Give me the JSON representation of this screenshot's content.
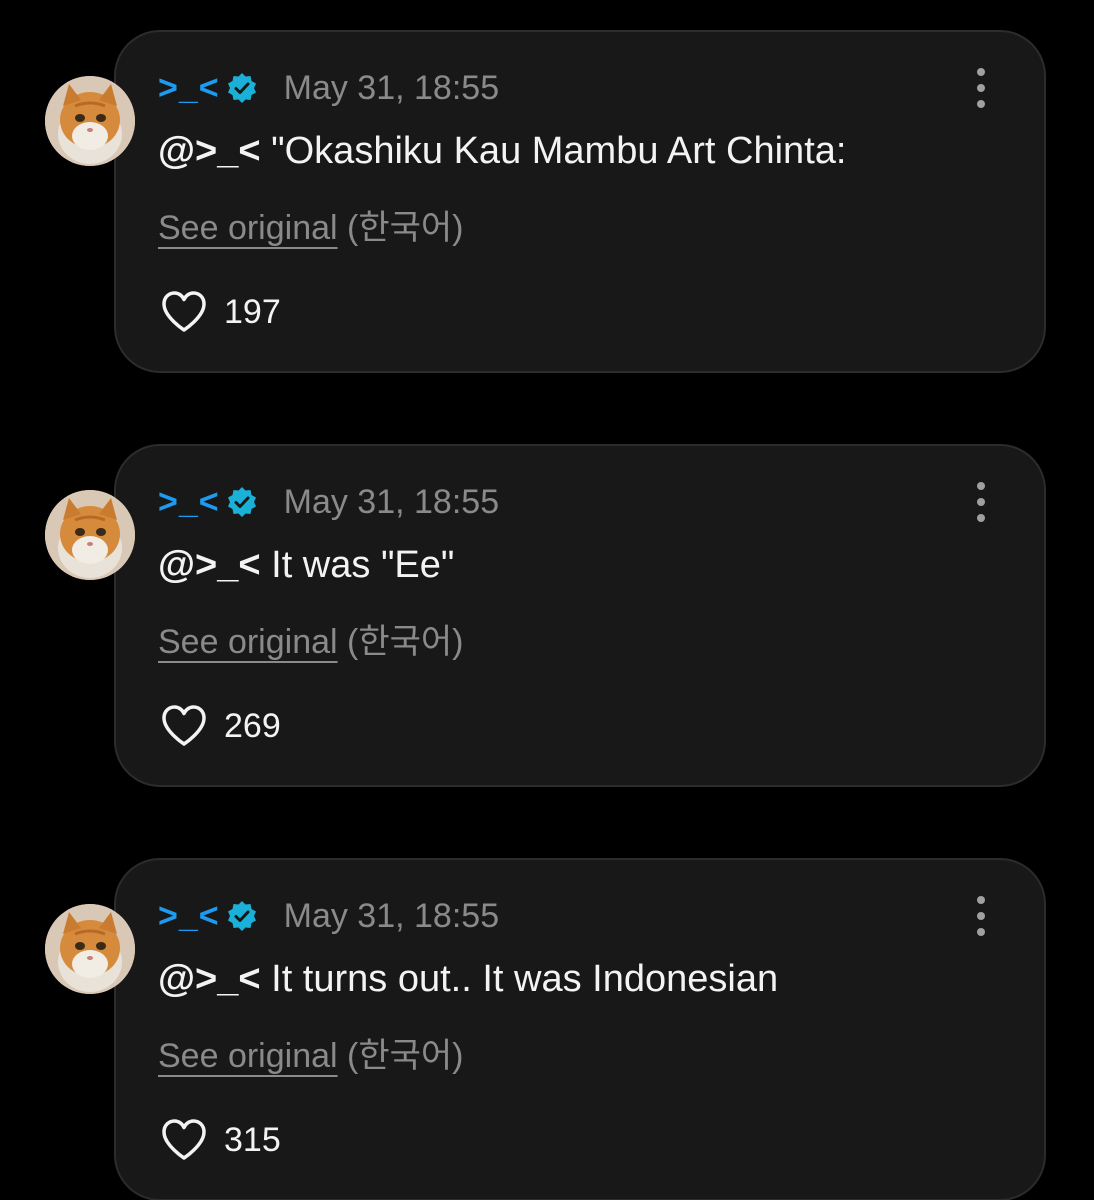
{
  "comments": [
    {
      "username": ">_<",
      "timestamp": "May 31, 18:55",
      "mention": "@>_<",
      "text": " \"Okashiku Kau Mambu Art Chinta:",
      "see_original": "See original",
      "language": " (한국어)",
      "likes": "197"
    },
    {
      "username": ">_<",
      "timestamp": "May 31, 18:55",
      "mention": "@>_<",
      "text": " It was \"Ee\"",
      "see_original": "See original",
      "language": " (한국어)",
      "likes": "269"
    },
    {
      "username": ">_<",
      "timestamp": "May 31, 18:55",
      "mention": "@>_<",
      "text": " It turns out.. It was Indonesian",
      "see_original": "See original",
      "language": " (한국어)",
      "likes": "315"
    }
  ],
  "colors": {
    "background": "#000000",
    "card": "#181818",
    "username": "#1d9bf0",
    "verified": "#1ab0d8",
    "muted": "#8a8a8a",
    "text": "#f3f3f3"
  },
  "icons": {
    "avatar": "orange-cat-avatar",
    "verified": "verified-badge-icon",
    "more": "more-vertical-icon",
    "like": "heart-outline-icon"
  }
}
